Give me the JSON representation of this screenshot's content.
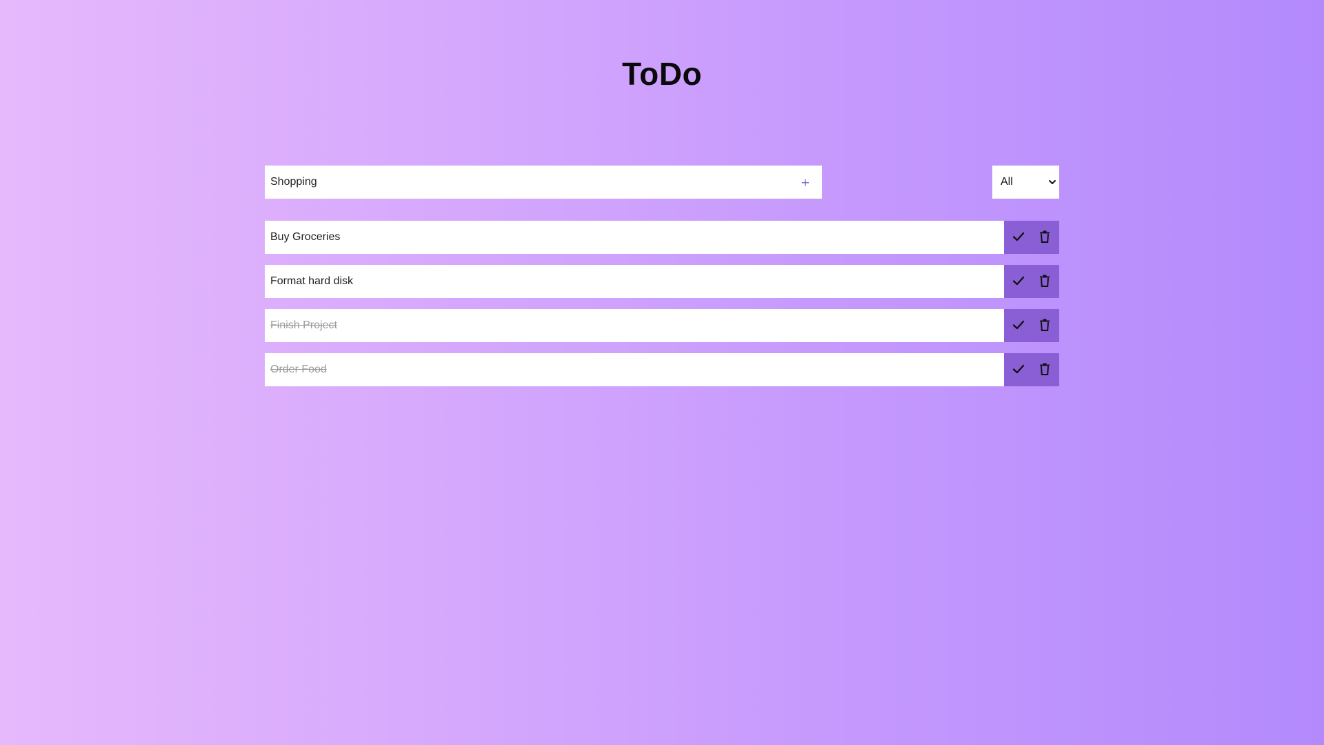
{
  "app": {
    "title": "ToDo"
  },
  "add_form": {
    "input_value": "Shopping",
    "add_icon": "plus-icon",
    "add_label": "+"
  },
  "filter": {
    "selected": "All",
    "icon": "chevron-down-icon"
  },
  "todos": [
    {
      "text": "Buy Groceries",
      "completed": false
    },
    {
      "text": "Format hard disk",
      "completed": false
    },
    {
      "text": "Finish Project",
      "completed": true
    },
    {
      "text": "Order Food",
      "completed": true
    }
  ],
  "item_actions": {
    "complete_icon": "check-icon",
    "delete_icon": "trash-icon"
  },
  "colors": {
    "background_start": "#e6b8fc",
    "background_end": "#b38afc",
    "action_bg": "#8a5fd6",
    "add_icon": "#7a5ad0",
    "completed_text": "#9a9a9a"
  }
}
